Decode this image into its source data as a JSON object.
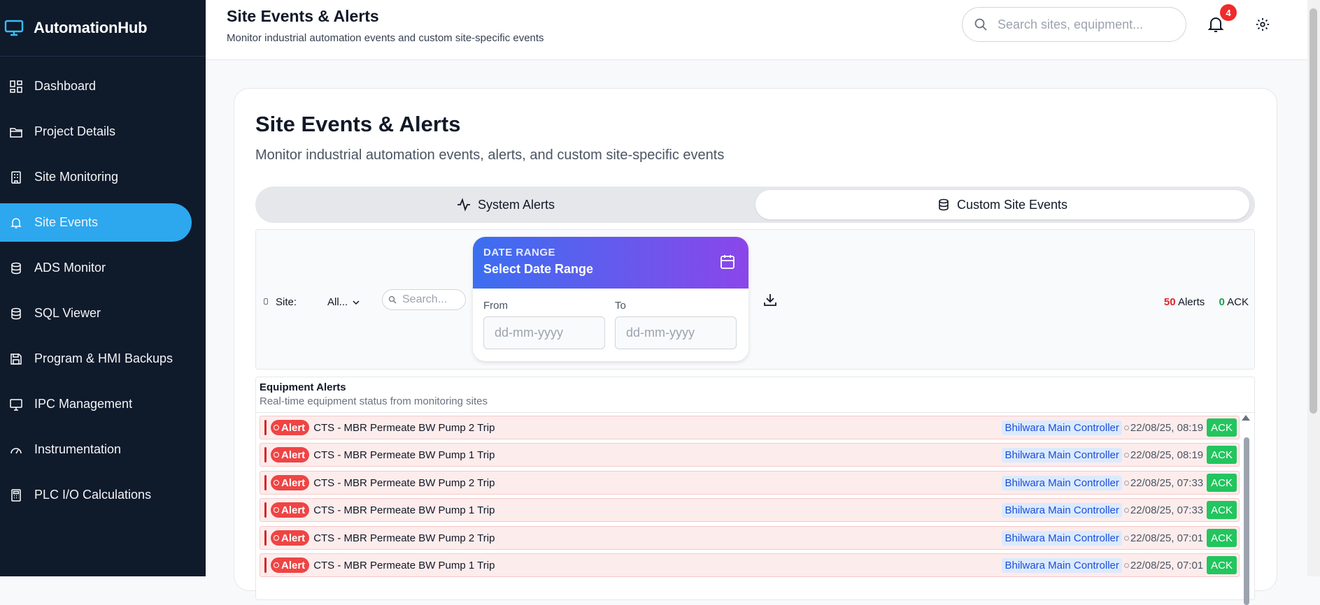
{
  "app": {
    "name": "AutomationHub"
  },
  "sidebar": {
    "items": [
      {
        "label": "Dashboard",
        "icon": "dashboard-icon"
      },
      {
        "label": "Project Details",
        "icon": "folder-icon"
      },
      {
        "label": "Site Monitoring",
        "icon": "building-icon"
      },
      {
        "label": "Site Events",
        "icon": "bell-icon",
        "active": true
      },
      {
        "label": "ADS Monitor",
        "icon": "database-icon"
      },
      {
        "label": "SQL Viewer",
        "icon": "database-icon"
      },
      {
        "label": "Program & HMI Backups",
        "icon": "save-icon"
      },
      {
        "label": "IPC Management",
        "icon": "monitor-icon"
      },
      {
        "label": "Instrumentation",
        "icon": "gauge-icon"
      },
      {
        "label": "PLC I/O Calculations",
        "icon": "calculator-icon"
      }
    ]
  },
  "header": {
    "title": "Site Events & Alerts",
    "subtitle": "Monitor industrial automation events and custom site-specific events",
    "search_placeholder": "Search sites, equipment...",
    "notification_count": "4"
  },
  "main": {
    "title": "Site Events & Alerts",
    "subtitle": "Monitor industrial automation events, alerts, and custom site-specific events",
    "tabs": [
      {
        "label": "System Alerts",
        "icon": "activity-icon"
      },
      {
        "label": "Custom Site Events",
        "icon": "database-icon",
        "selected": true
      }
    ]
  },
  "filters": {
    "site_label": "Site:",
    "site_value": "All...",
    "search_placeholder": "Search...",
    "date_range": {
      "kicker": "DATE RANGE",
      "title": "Select Date Range",
      "from_label": "From",
      "to_label": "To",
      "from_placeholder": "dd-mm-yyyy",
      "to_placeholder": "dd-mm-yyyy"
    },
    "alerts_count": "50",
    "alerts_label": "Alerts",
    "ack_count": "0",
    "ack_label": "ACK"
  },
  "alerts": {
    "title": "Equipment Alerts",
    "subtitle": "Real-time equipment status from monitoring sites",
    "badge_label": "Alert",
    "ack_button": "ACK",
    "rows": [
      {
        "text": "CTS - MBR Permeate BW Pump 2 Trip",
        "site": "Bhilwara Main Controller",
        "time": "22/08/25, 08:19"
      },
      {
        "text": "CTS - MBR Permeate BW Pump 1 Trip",
        "site": "Bhilwara Main Controller",
        "time": "22/08/25, 08:19"
      },
      {
        "text": "CTS - MBR Permeate BW Pump 2 Trip",
        "site": "Bhilwara Main Controller",
        "time": "22/08/25, 07:33"
      },
      {
        "text": "CTS - MBR Permeate BW Pump 1 Trip",
        "site": "Bhilwara Main Controller",
        "time": "22/08/25, 07:33"
      },
      {
        "text": "CTS - MBR Permeate BW Pump 2 Trip",
        "site": "Bhilwara Main Controller",
        "time": "22/08/25, 07:01"
      },
      {
        "text": "CTS - MBR Permeate BW Pump 1 Trip",
        "site": "Bhilwara Main Controller",
        "time": "22/08/25, 07:01"
      }
    ]
  },
  "colors": {
    "sidebar_bg": "#0f1a2b",
    "active_nav": "#2da7ee",
    "alert_red": "#ef4444",
    "ack_green": "#22c55e"
  }
}
